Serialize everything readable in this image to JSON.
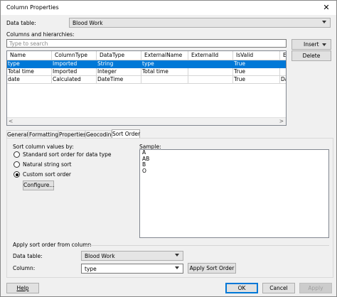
{
  "window": {
    "title": "Column Properties",
    "close_glyph": "✕"
  },
  "data_table": {
    "label": "Data table:",
    "value": "Blood Work"
  },
  "columns_section": {
    "label": "Columns and hierarchies:",
    "search_placeholder": "Type to search"
  },
  "side_buttons": {
    "insert": "Insert",
    "delete": "Delete"
  },
  "grid": {
    "headers": [
      "Name",
      "ColumnType",
      "DataType",
      "ExternalName",
      "ExternalId",
      "IsValid",
      "Ex"
    ],
    "rows": [
      [
        "type",
        "Imported",
        "String",
        "type",
        "",
        "True",
        ""
      ],
      [
        "Total time",
        "Imported",
        "Integer",
        "Total time",
        "",
        "True",
        ""
      ],
      [
        "date",
        "Calculated",
        "DateTime",
        "",
        "",
        "True",
        "Da"
      ]
    ],
    "selected_row": 0,
    "scroll_left_glyph": "<",
    "scroll_right_glyph": ">"
  },
  "tabs": [
    "General",
    "Formatting",
    "Properties",
    "Geocoding",
    "Sort Order"
  ],
  "active_tab": 4,
  "sort_order": {
    "group_label": "Sort column values by:",
    "options": [
      "Standard sort order for data type",
      "Natural string sort",
      "Custom sort order"
    ],
    "selected": 2,
    "configure_label": "Configure...",
    "sample_label": "Sample:",
    "sample_values": [
      "A",
      "AB",
      "B",
      "O"
    ],
    "apply_from_label": "Apply sort order from column",
    "apply_table_label": "Data table:",
    "apply_table_value": "Blood Work",
    "apply_column_label": "Column:",
    "apply_column_value": "type",
    "apply_button": "Apply Sort Order"
  },
  "footer": {
    "help": "Help",
    "ok": "OK",
    "cancel": "Cancel",
    "apply": "Apply"
  }
}
